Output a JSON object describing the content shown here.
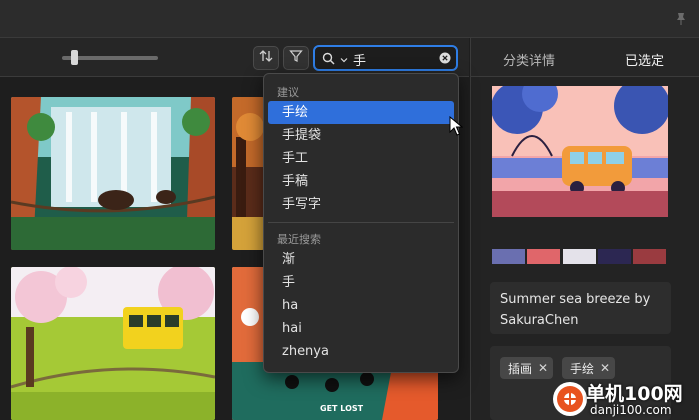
{
  "toolbar": {
    "zoom_level": 0.15,
    "search": {
      "value": "手",
      "placeholder": ""
    }
  },
  "right_header": {
    "tab_detail": "分类详情",
    "tab_selected": "已选定"
  },
  "dropdown": {
    "suggestions_label": "建议",
    "suggestions": [
      "手绘",
      "手提袋",
      "手工",
      "手稿",
      "手写字"
    ],
    "active_index": 0,
    "recent_label": "最近搜索",
    "recent": [
      "渐",
      "手",
      "ha",
      "hai",
      "zhenya"
    ]
  },
  "detail": {
    "palette": [
      "#6a6fb0",
      "#e0666a",
      "#e4e2ea",
      "#2c2752",
      "#9a3b40"
    ],
    "title": "Summer sea breeze by SakuraChen",
    "tags": [
      "插画",
      "手绘"
    ],
    "tag_close": "✕"
  },
  "grid": {
    "caption": "GET LOST"
  },
  "watermark": {
    "title": "单机100网",
    "url": "danji100.com"
  }
}
